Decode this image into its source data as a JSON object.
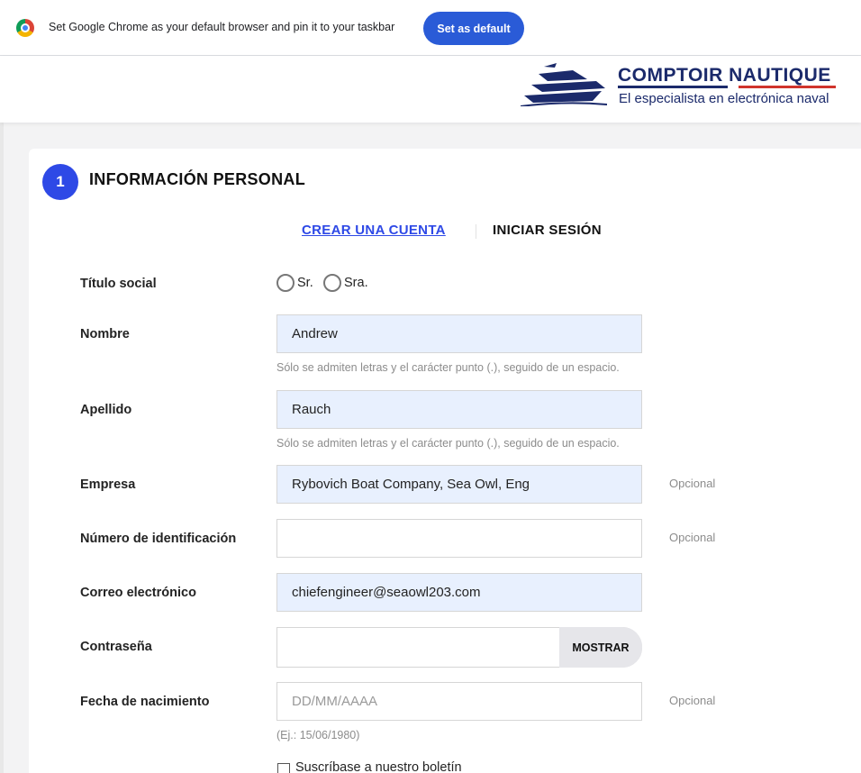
{
  "infobar": {
    "message": "Set Google Chrome as your default browser and pin it to your taskbar",
    "button_label": "Set as default"
  },
  "header": {
    "brand_name": "COMPTOIR NAUTIQUE",
    "tagline": "El especialista en electrónica naval",
    "colors": {
      "brand_blue": "#1b2a6b",
      "brand_red": "#d0342c"
    }
  },
  "section": {
    "step_number": "1",
    "title": "INFORMACIÓN PERSONAL",
    "tabs": [
      {
        "label": "CREAR UNA CUENTA",
        "active": true
      },
      {
        "label": "INICIAR SESIÓN",
        "active": false
      }
    ],
    "accent_color": "#2e49e6"
  },
  "form": {
    "social_title": {
      "label": "Título social",
      "options": [
        "Sr.",
        "Sra."
      ]
    },
    "first_name": {
      "label": "Nombre",
      "value": "Andrew",
      "hint": "Sólo se admiten letras y el carácter punto (.), seguido de un espacio."
    },
    "last_name": {
      "label": "Apellido",
      "value": "Rauch",
      "hint": "Sólo se admiten letras y el carácter punto (.), seguido de un espacio."
    },
    "company": {
      "label": "Empresa",
      "value": "Rybovich Boat Company, Sea Owl, Eng",
      "optional": "Opcional"
    },
    "id_number": {
      "label": "Número de identificación",
      "value": "",
      "optional": "Opcional"
    },
    "email": {
      "label": "Correo electrónico",
      "value": "chiefengineer@seaowl203.com"
    },
    "password": {
      "label": "Contraseña",
      "show_label": "MOSTRAR"
    },
    "birthdate": {
      "label": "Fecha de nacimiento",
      "placeholder": "DD/MM/AAAA",
      "optional": "Opcional",
      "hint": "(Ej.: 15/06/1980)"
    },
    "newsletter": {
      "label": "Suscríbase a nuestro boletín"
    }
  }
}
